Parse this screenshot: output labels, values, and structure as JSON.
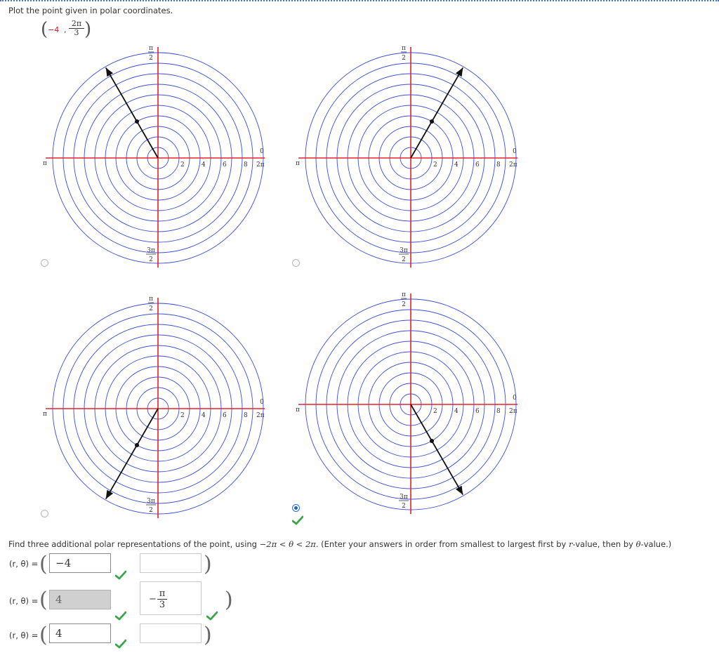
{
  "prompt": "Plot the point given in polar coordinates.",
  "given_point": {
    "r": "−4",
    "theta_num": "2π",
    "theta_den": "3"
  },
  "graph": {
    "angle_labels": {
      "top_num": "π",
      "top_den": "2",
      "right_zero": "0",
      "right_two_pi": "2π",
      "left": "π",
      "bottom_num": "3π",
      "bottom_den": "2"
    },
    "tick_labels": [
      "2",
      "4",
      "6",
      "8"
    ],
    "options": [
      {
        "id": "option-1",
        "ray_angle_deg": 120,
        "point_r": 4,
        "selected": false
      },
      {
        "id": "option-2",
        "ray_angle_deg": 60,
        "point_r": 4,
        "selected": false
      },
      {
        "id": "option-3",
        "ray_angle_deg": 240,
        "point_r": 4,
        "selected": false
      },
      {
        "id": "option-4",
        "ray_angle_deg": 300,
        "point_r": 4,
        "selected": true
      }
    ],
    "colors": {
      "circle": "#3a4fd6",
      "axis": "#e8202a",
      "ray": "#111111"
    }
  },
  "instructions": {
    "p1": "Find three additional polar representations of the point, using ",
    "math": "−2π < θ < 2π",
    "p2": ". (Enter your answers in order from smallest to largest first by ",
    "rvar": "r",
    "p3": "-value, then by ",
    "tvar": "θ",
    "p4": "-value.)"
  },
  "answer_rows": [
    {
      "label": "(r, θ) =",
      "r_value": "−4",
      "theta_value": ""
    },
    {
      "label": "(r, θ) =",
      "r_value": "4",
      "theta_value": "−π/3",
      "theta_sign": "−",
      "theta_num": "π",
      "theta_den": "3"
    },
    {
      "label": "(r, θ) =",
      "r_value": "4",
      "theta_value": ""
    }
  ],
  "status": {
    "check_color": "#3aa64a",
    "radio_color": "#1a64d6"
  }
}
